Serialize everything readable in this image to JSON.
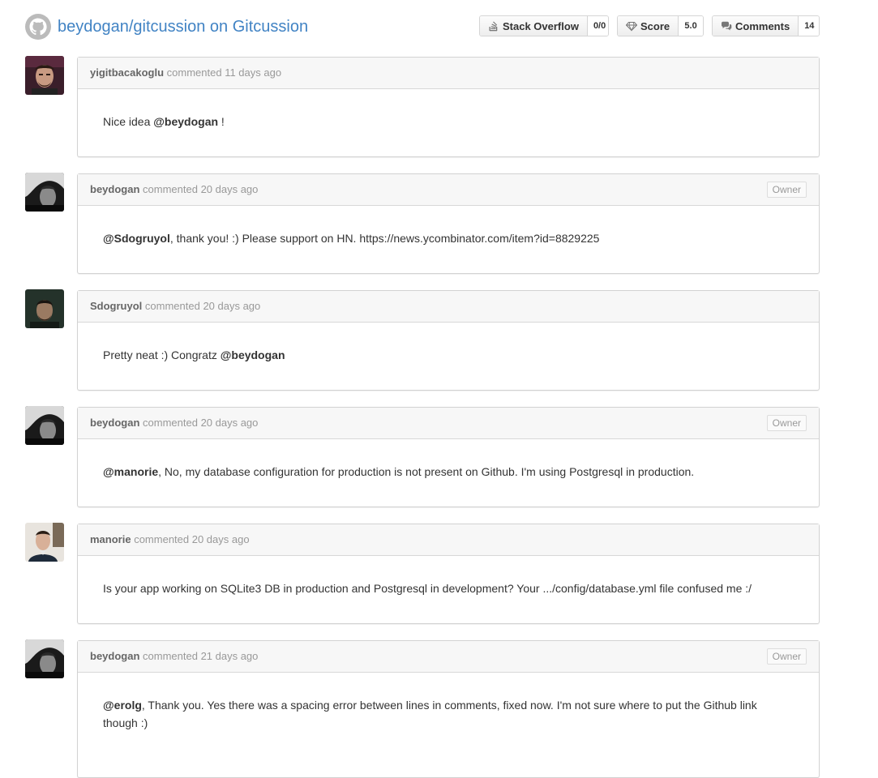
{
  "header": {
    "repo_title": "beydogan/gitcussion on Gitcussion",
    "logo_icon": "github-octocat-icon",
    "buttons": {
      "stackoverflow": {
        "label": "Stack Overflow",
        "count": "0/0",
        "icon": "stackoverflow-icon"
      },
      "score": {
        "label": "Score",
        "count": "5.0",
        "icon": "diamond-icon"
      },
      "comments": {
        "label": "Comments",
        "count": "14",
        "icon": "comment-bubble-icon"
      }
    }
  },
  "owner_label": "Owner",
  "comments": [
    {
      "author": "yigitbacakoglu",
      "meta": "commented 11 days ago",
      "is_owner": false,
      "parts": [
        {
          "text": "Nice idea "
        },
        {
          "mention": "@beydogan"
        },
        {
          "text": " !"
        }
      ]
    },
    {
      "author": "beydogan",
      "meta": "commented 20 days ago",
      "is_owner": true,
      "parts": [
        {
          "mention": "@Sdogruyol"
        },
        {
          "text": ", thank you! :) Please support on HN. https://news.ycombinator.com/item?id=8829225"
        }
      ]
    },
    {
      "author": "Sdogruyol",
      "meta": "commented 20 days ago",
      "is_owner": false,
      "parts": [
        {
          "text": "Pretty neat :) Congratz "
        },
        {
          "mention": "@beydogan"
        }
      ]
    },
    {
      "author": "beydogan",
      "meta": "commented 20 days ago",
      "is_owner": true,
      "parts": [
        {
          "mention": "@manorie"
        },
        {
          "text": ", No, my database configuration for production is not present on Github. I'm using Postgresql in production."
        }
      ]
    },
    {
      "author": "manorie",
      "meta": "commented 20 days ago",
      "is_owner": false,
      "parts": [
        {
          "text": "Is your app working on SQLite3 DB in production and Postgresql in development? Your .../config/database.yml file confused me :/"
        }
      ]
    },
    {
      "author": "beydogan",
      "meta": "commented 21 days ago",
      "is_owner": true,
      "parts": [
        {
          "mention": "@erolg"
        },
        {
          "text": ", Thank you. Yes there was a spacing error between lines in comments, fixed now. I'm not sure where to put the Github link though :)"
        }
      ]
    }
  ],
  "colors": {
    "link": "#4183c4",
    "header_bg": "#f7f7f7",
    "border": "#d2d2d2"
  }
}
